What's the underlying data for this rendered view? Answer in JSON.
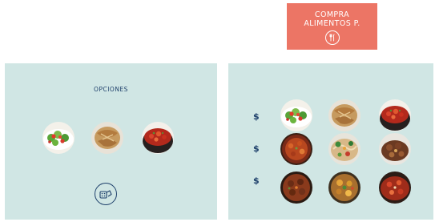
{
  "compra_button": {
    "line1": "COMPRA",
    "line2": "ALIMENTOS P.",
    "icon": "fork-knife-icon"
  },
  "options_panel": {
    "title": "OPCIONES",
    "dishes": [
      "salad",
      "fried-chicken",
      "tomato-stew"
    ],
    "swap_icon": "dice-swap-icon"
  },
  "grid_panel": {
    "rows": [
      {
        "price": "$",
        "dishes": [
          "salad",
          "fried-chicken",
          "tomato-stew"
        ]
      },
      {
        "price": "$",
        "dishes": [
          "tomato-stew",
          "noodle-salad",
          "beef-stew"
        ]
      },
      {
        "price": "$",
        "dishes": [
          "meatball-stew",
          "chicken-potatoes",
          "tomato-stew"
        ]
      }
    ]
  }
}
